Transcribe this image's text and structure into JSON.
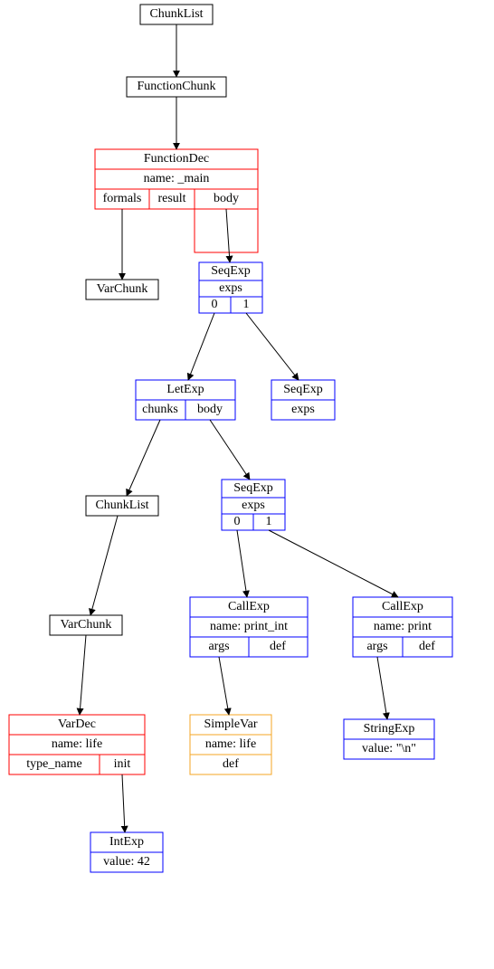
{
  "nodes": {
    "chunklist1": {
      "label": "ChunkList"
    },
    "functionchunk": {
      "label": "FunctionChunk"
    },
    "functiondec": {
      "title": "FunctionDec",
      "row2": "name: _main",
      "row3": {
        "formals": "formals",
        "result": "result",
        "body": "body"
      }
    },
    "varchunk1": {
      "label": "VarChunk"
    },
    "seqexp1": {
      "title": "SeqExp",
      "row2_label": "exps",
      "row3": {
        "c0": "0",
        "c1": "1"
      }
    },
    "letexp": {
      "title": "LetExp",
      "row2": {
        "chunks": "chunks",
        "body": "body"
      }
    },
    "seqexp_empty": {
      "title": "SeqExp",
      "row2_label": "exps"
    },
    "chunklist2": {
      "label": "ChunkList"
    },
    "seqexp2": {
      "title": "SeqExp",
      "row2_label": "exps",
      "row3": {
        "c0": "0",
        "c1": "1"
      }
    },
    "varchunk2": {
      "label": "VarChunk"
    },
    "callexp1": {
      "title": "CallExp",
      "row2": "name: print_int",
      "row3": {
        "args": "args",
        "def": "def"
      }
    },
    "callexp2": {
      "title": "CallExp",
      "row2": "name: print",
      "row3": {
        "args": "args",
        "def": "def"
      }
    },
    "vardec": {
      "title": "VarDec",
      "row2": "name: life",
      "row3": {
        "type_name": "type_name",
        "init": "init"
      }
    },
    "simplevar": {
      "title": "SimpleVar",
      "row2": "name: life",
      "row3": "def"
    },
    "stringexp": {
      "title": "StringExp",
      "row2": "value: \"\\n\""
    },
    "intexp": {
      "title": "IntExp",
      "row2": "value: 42"
    }
  }
}
